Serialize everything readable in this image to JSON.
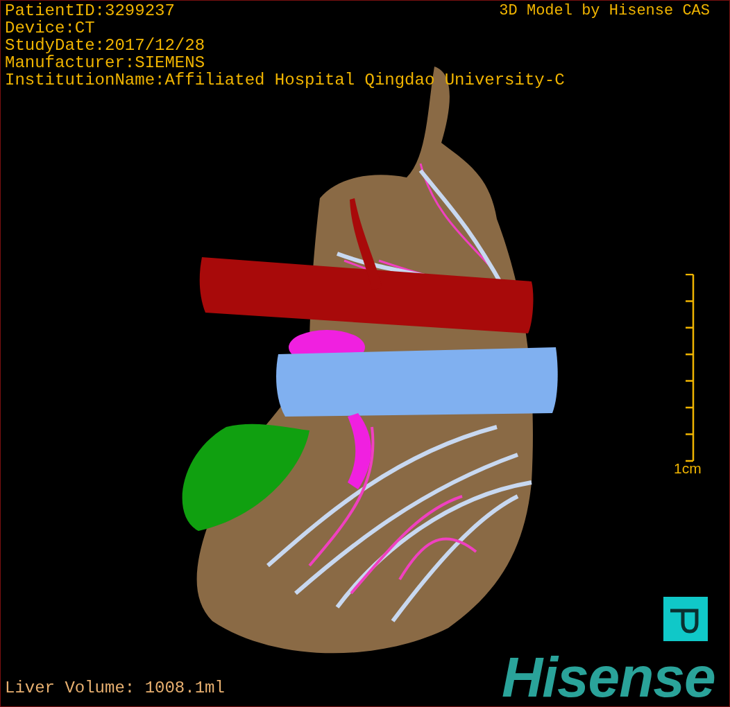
{
  "patient_info": [
    "PatientID:3299237",
    "Device:CT",
    "StudyDate:2017/12/28",
    "Manufacturer:SIEMENS",
    "InstitutionName:Affiliated Hospital Qingdao University-C"
  ],
  "title": "3D Model by Hisense CAS",
  "scale_bar": {
    "label": "1cm"
  },
  "liver_volume": "Liver Volume: 1008.1ml",
  "brand": "Hisense"
}
